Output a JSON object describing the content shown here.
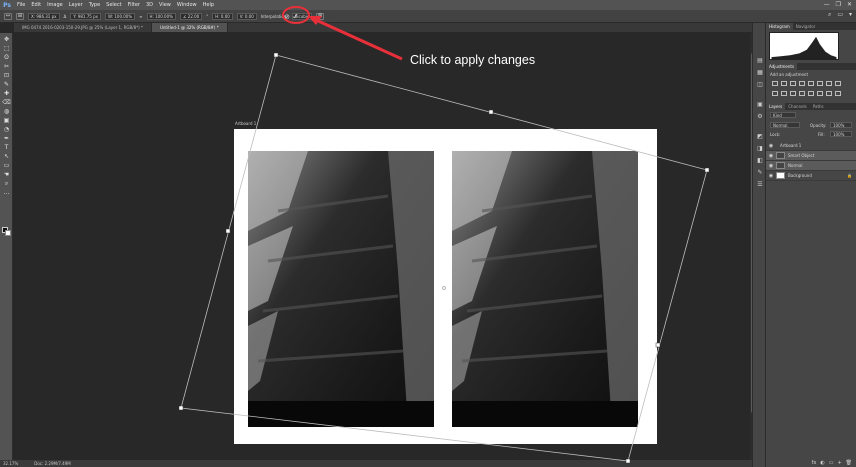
{
  "app": {
    "logo": "Ps",
    "menu": [
      "File",
      "Edit",
      "Image",
      "Layer",
      "Type",
      "Select",
      "Filter",
      "3D",
      "View",
      "Window",
      "Help"
    ],
    "window_controls": [
      "—",
      "❐",
      "✕"
    ]
  },
  "options_bar": {
    "fields": [
      "X: 986.31 px",
      "Δ",
      "Y: 981.75 px",
      "W: 100.00%",
      "∞",
      "H: 100.00%",
      "∠ 22.00",
      "°",
      "H: 0.00",
      "V: 0.00"
    ],
    "interpolation_label": "Interpolation:",
    "interpolation_value": "Bicubic",
    "cancel_symbol": "⊘",
    "confirm_symbol": "✓",
    "right_icons": [
      "⌕",
      "▭",
      "▾"
    ]
  },
  "tabs": [
    {
      "label": "IMG 0474 2016-0203-150-29.JPG @ 25% (Layer 1, RGB/8*) *"
    },
    {
      "label": "Untitled-1 @ 32% (RGB/8#) *"
    }
  ],
  "artboard": {
    "label": "Artboard 1"
  },
  "status": {
    "zoom": "32.17%",
    "doc": "Doc: 2.29M/7.49M"
  },
  "annotation": {
    "text": "Click to apply changes",
    "color": "#e8303a"
  },
  "panels": {
    "histogram_tabs": [
      "Histogram",
      "Navigator"
    ],
    "adjustments_tab": "Adjustments",
    "adjustments_hint": "Add an adjustment",
    "layers_tabs": [
      "Layers",
      "Channels",
      "Paths"
    ],
    "kind_label": "Kind",
    "blend_mode": "Normal",
    "opacity_label": "Opacity:",
    "opacity_value": "100%",
    "lock_label": "Lock:",
    "fill_label": "Fill:",
    "fill_value": "100%",
    "layers": [
      {
        "name": "Artboard 1"
      },
      {
        "name": "Smart Object"
      },
      {
        "name": "Normal"
      },
      {
        "name": "Background"
      }
    ],
    "bottom_icons": [
      "fx",
      "◐",
      "▭",
      "+",
      "🗑"
    ]
  },
  "toolbar_icons": [
    "✥",
    "⬚",
    "ʘ",
    "✂",
    "⊡",
    "✎",
    "✚",
    "⌫",
    "◍",
    "▣",
    "◔",
    "✒",
    "T",
    "↖",
    "▭",
    "☚",
    "⌕",
    "…"
  ],
  "strip_icons": [
    "▤",
    "▦",
    "◫",
    "▣",
    "⚙",
    "◩",
    "◨",
    "◧",
    "✎",
    "☰"
  ],
  "colors": {
    "accent": "#e8303a",
    "ui_dark": "#282828",
    "panel": "#464646"
  }
}
